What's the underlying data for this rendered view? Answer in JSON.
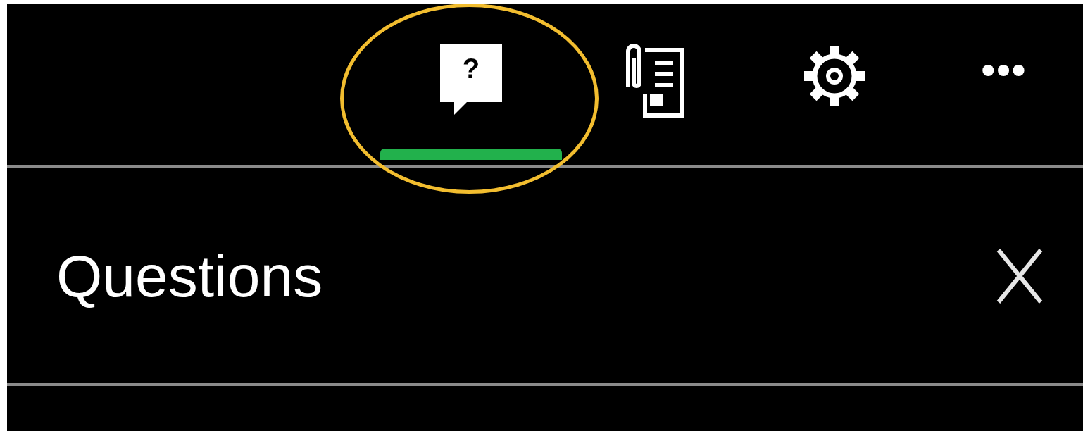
{
  "tabs": [
    {
      "kind": "questions",
      "glyph": "?",
      "selected": true,
      "highlighted": true
    },
    {
      "kind": "notes",
      "selected": false,
      "highlighted": false
    },
    {
      "kind": "settings",
      "selected": false,
      "highlighted": false
    }
  ],
  "more_button": {
    "glyph": "•••"
  },
  "panel": {
    "title": "Questions"
  }
}
